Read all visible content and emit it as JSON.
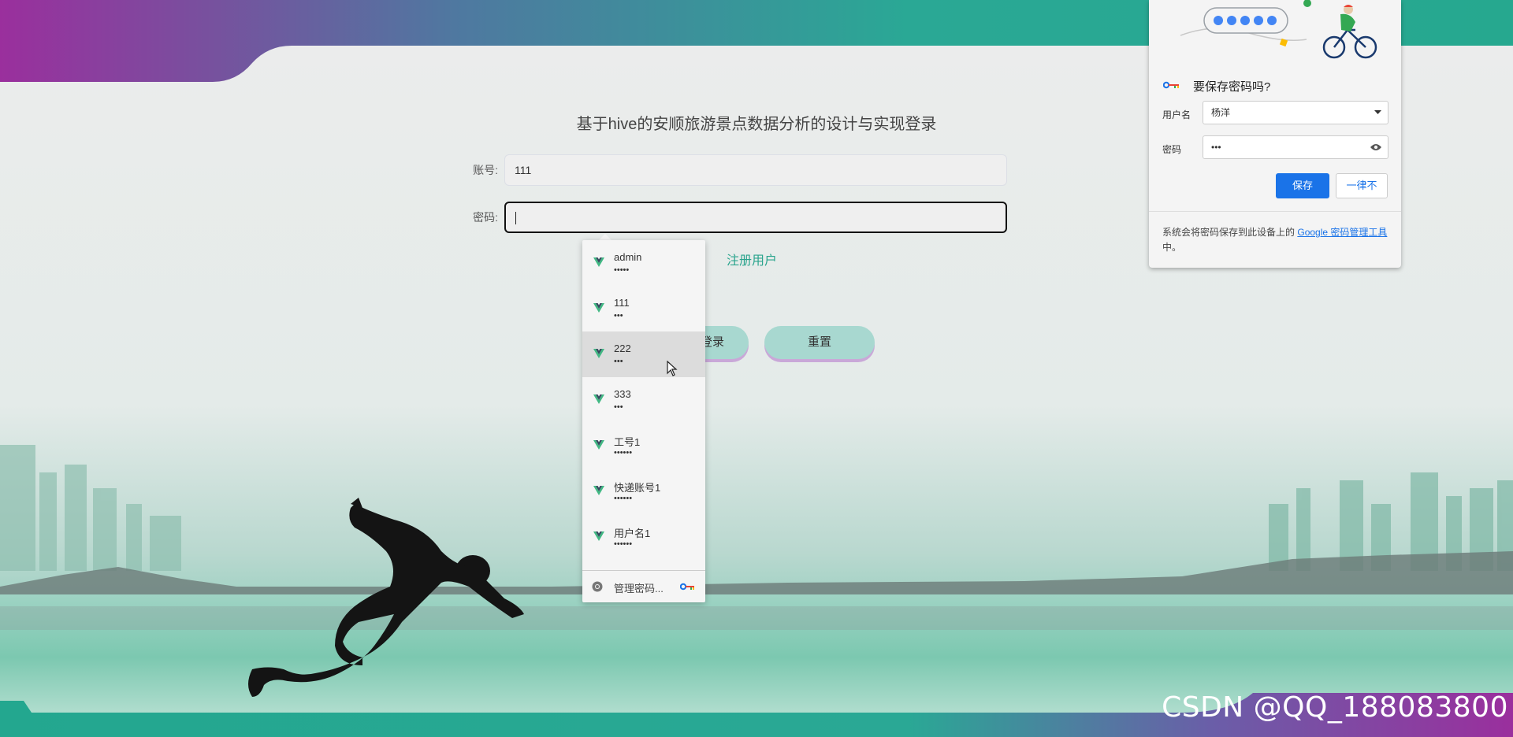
{
  "page": {
    "title": "基于hive的安顺旅游景点数据分析的设计与实现登录",
    "register_link": "注册用户"
  },
  "form": {
    "account_label": "账号:",
    "account_value": "111",
    "password_label": "密码:",
    "login_button": "登录",
    "reset_button": "重置"
  },
  "autofill": {
    "items": [
      {
        "username": "admin",
        "password_mask": "•••••"
      },
      {
        "username": "111",
        "password_mask": "•••"
      },
      {
        "username": "222",
        "password_mask": "•••"
      },
      {
        "username": "333",
        "password_mask": "•••"
      },
      {
        "username": "工号1",
        "password_mask": "••••••"
      },
      {
        "username": "快递账号1",
        "password_mask": "••••••"
      },
      {
        "username": "用户名1",
        "password_mask": "••••••"
      }
    ],
    "highlighted_index": 2,
    "manage_label": "管理密码..."
  },
  "save_password_popup": {
    "title": "要保存密码吗?",
    "username_label": "用户名",
    "username_value": "杨洋",
    "password_label": "密码",
    "password_mask": "•••",
    "save_button": "保存",
    "never_button": "一律不",
    "footer_text": "系统会将密码保存到此设备上的",
    "footer_link": "Google 密码管理工具",
    "footer_suffix": "中。"
  },
  "watermark": "CSDN @QQ_188083800",
  "colors": {
    "accent_teal": "#2aa48d",
    "purple": "#8e2f9e",
    "google_blue": "#1a73e8"
  }
}
